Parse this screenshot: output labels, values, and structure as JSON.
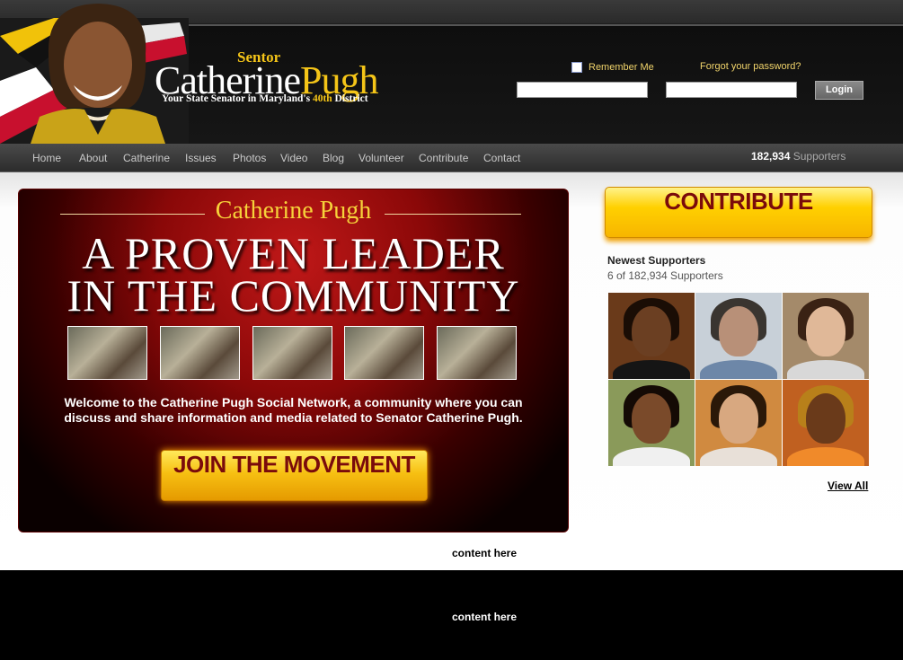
{
  "header": {
    "logo": {
      "sentor": "Sentor",
      "first_name": "Catherine",
      "last_name": "Pugh",
      "tagline_pre": "Your State Senator in Maryland's ",
      "tagline_hl": "40th",
      "tagline_post": " District"
    },
    "login": {
      "remember_label": "Remember Me",
      "forgot_label": "Forgot your password?",
      "username_value": "",
      "password_value": "",
      "button_label": "Login"
    }
  },
  "nav": {
    "items": [
      "Home",
      "About",
      "Catherine",
      "Issues",
      "Photos",
      "Video",
      "Blog",
      "Volunteer",
      "Contribute",
      "Contact"
    ],
    "supporters_count": "182,934",
    "supporters_label": " Supporters"
  },
  "banner": {
    "title": "Catherine Pugh",
    "headline_1": "A PROVEN LEADER",
    "headline_2": "IN THE COMMUNITY",
    "welcome_1": "Welcome to the Catherine Pugh Social Network, a community where you can",
    "welcome_2": "discuss and share information and media related to Senator Catherine Pugh.",
    "join_label": "JOIN THE MOVEMENT"
  },
  "sidebar": {
    "contribute_label": "CONTRIBUTE",
    "newest_title": "Newest Supporters",
    "newest_sub": "6 of 182,934 Supporters",
    "view_all": "View All"
  },
  "placeholders": {
    "content_1": "content here",
    "content_2": "content here"
  },
  "colors": {
    "gold": "#f5c518",
    "banner_red": "#8a0808",
    "button_text": "#7a0b0b"
  }
}
